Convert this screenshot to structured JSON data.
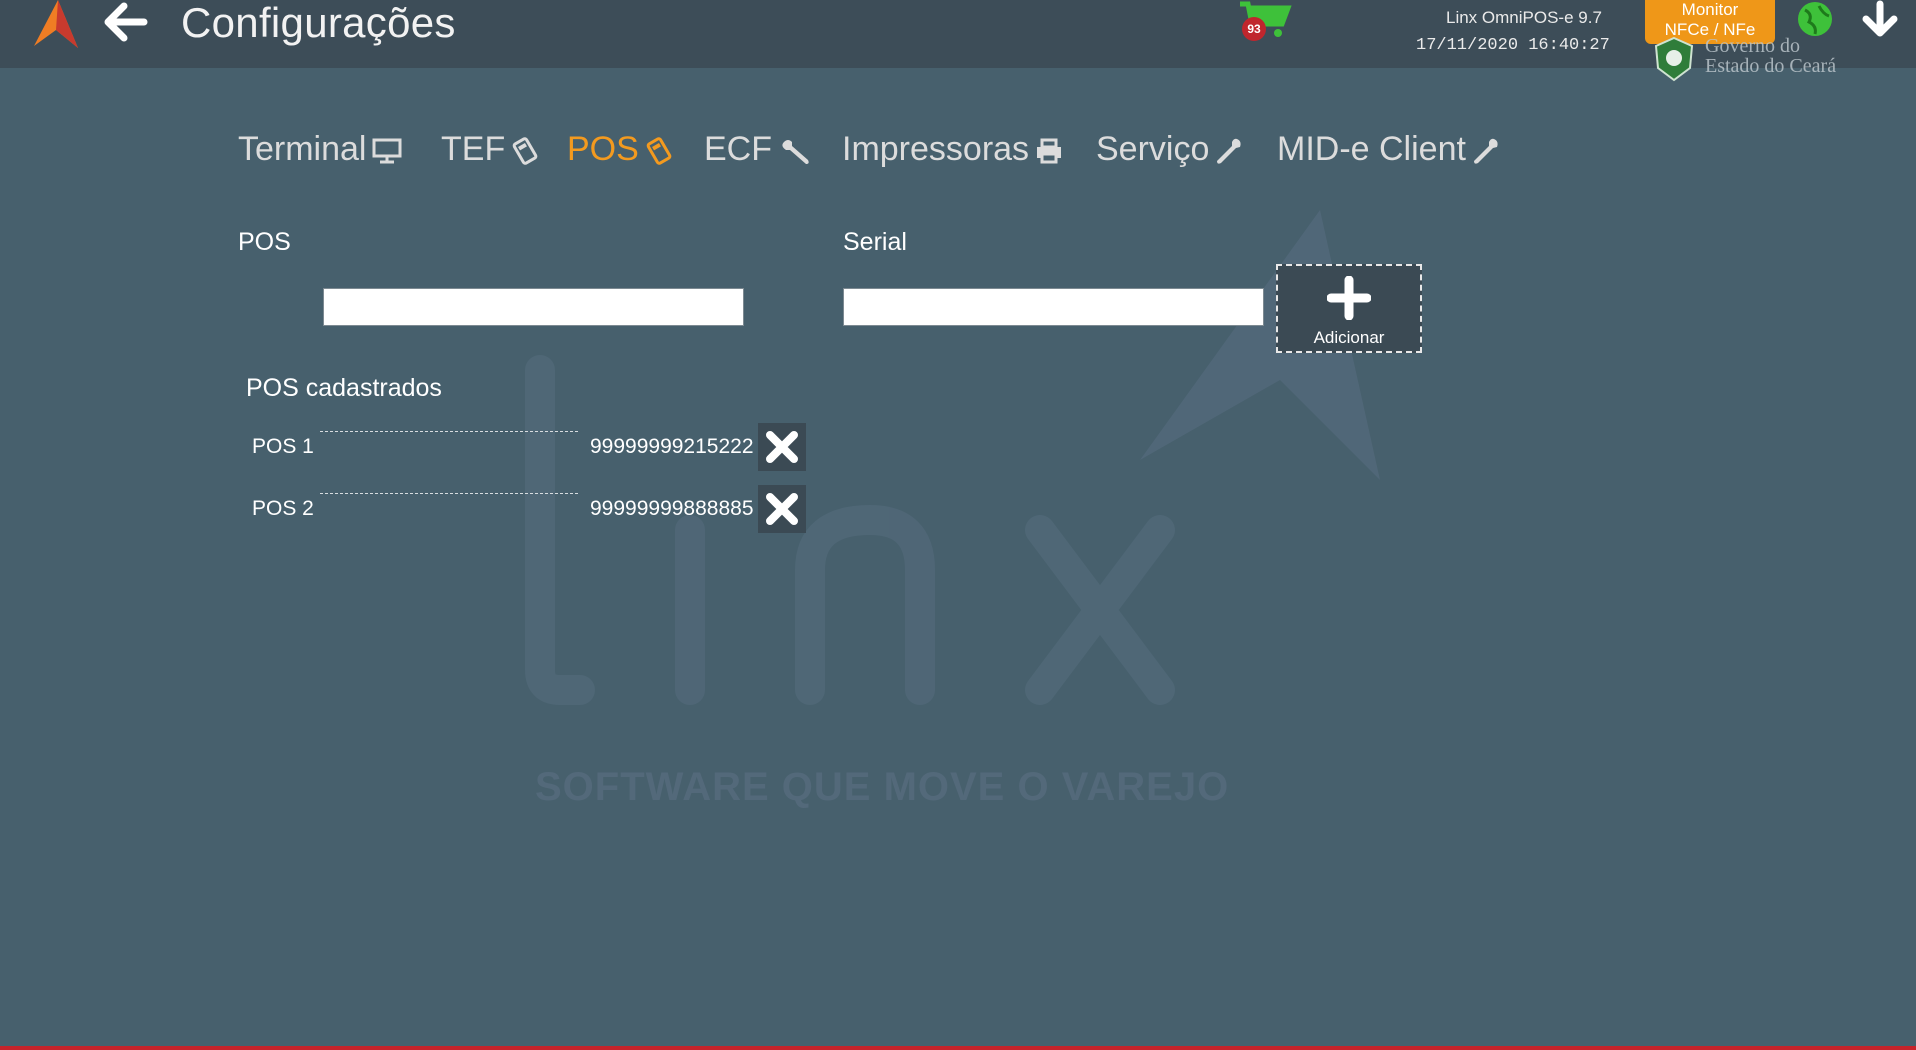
{
  "header": {
    "title": "Configurações",
    "cart_count": "93",
    "app_version": "Linx OmniPOS-e  9.7",
    "datetime": "17/11/2020 16:40:27",
    "monitor_label_1": "Monitor",
    "monitor_label_2": "NFCe / NFe",
    "gov_line_1": "Governo do",
    "gov_line_2": "Estado do Ceará"
  },
  "tabs": [
    {
      "label": "Terminal",
      "icon": "monitor-icon"
    },
    {
      "label": "TEF",
      "icon": "card-terminal-icon"
    },
    {
      "label": "POS",
      "icon": "card-terminal-icon",
      "active": true
    },
    {
      "label": "ECF",
      "icon": "wrench-icon"
    },
    {
      "label": "Impressoras",
      "icon": "printer-icon"
    },
    {
      "label": "Serviço",
      "icon": "wrench-icon"
    },
    {
      "label": "MID-e Client",
      "icon": "wrench-icon"
    }
  ],
  "form": {
    "pos_label": "POS",
    "pos_value": "",
    "serial_label": "Serial",
    "serial_value": "",
    "add_label": "Adicionar"
  },
  "registered": {
    "title": "POS cadastrados",
    "items": [
      {
        "name": "POS 1",
        "serial": "99999999215222"
      },
      {
        "name": "POS 2",
        "serial": "99999999888885"
      }
    ]
  },
  "watermark": {
    "brand": "linx",
    "tagline": "SOFTWARE QUE MOVE O VAREJO"
  },
  "colors": {
    "background": "#47606d",
    "topbar": "#3d4d58",
    "accent": "#f39a1f",
    "monitor_button": "#ef9718"
  }
}
